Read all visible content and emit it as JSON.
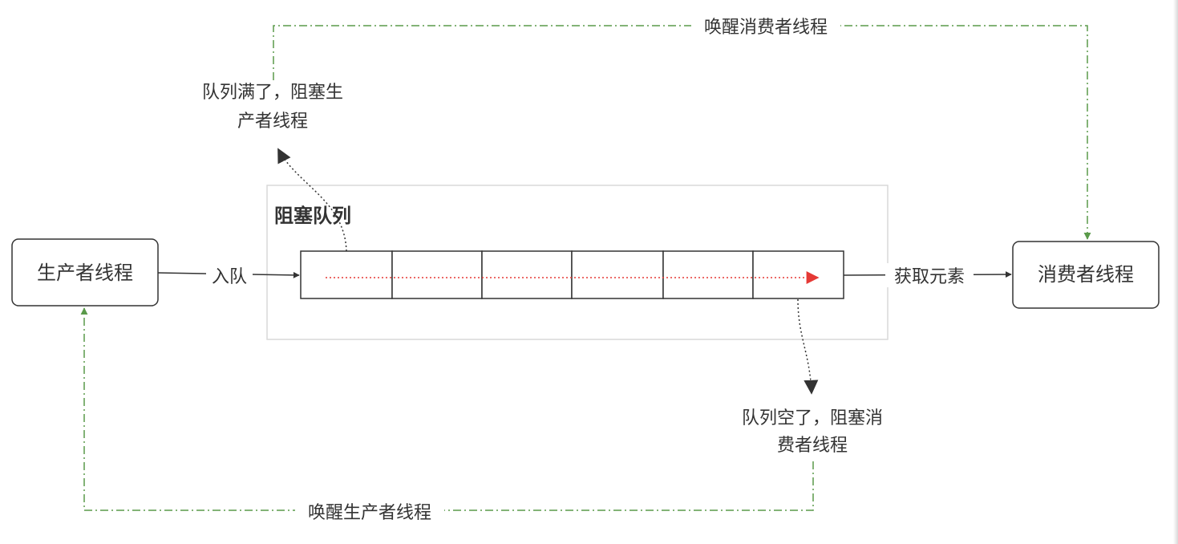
{
  "diagram": {
    "producer_label": "生产者线程",
    "consumer_label": "消费者线程",
    "queue_title": "阻塞队列",
    "enqueue_label": "入队",
    "take_label": "获取元素",
    "full_note_line1": "队列满了，阻塞生",
    "full_note_line2": "产者线程",
    "empty_note_line1": "队列空了，阻塞消",
    "empty_note_line2": "费者线程",
    "wake_consumer_label": "唤醒消费者线程",
    "wake_producer_label": "唤醒生产者线程",
    "queue_slot_count": 6
  },
  "colors": {
    "solid_arrow": "#333333",
    "wake_arrow": "#5a9a4a",
    "flow_arrow": "#e53935",
    "queue_container_border": "#d9d9d9"
  }
}
